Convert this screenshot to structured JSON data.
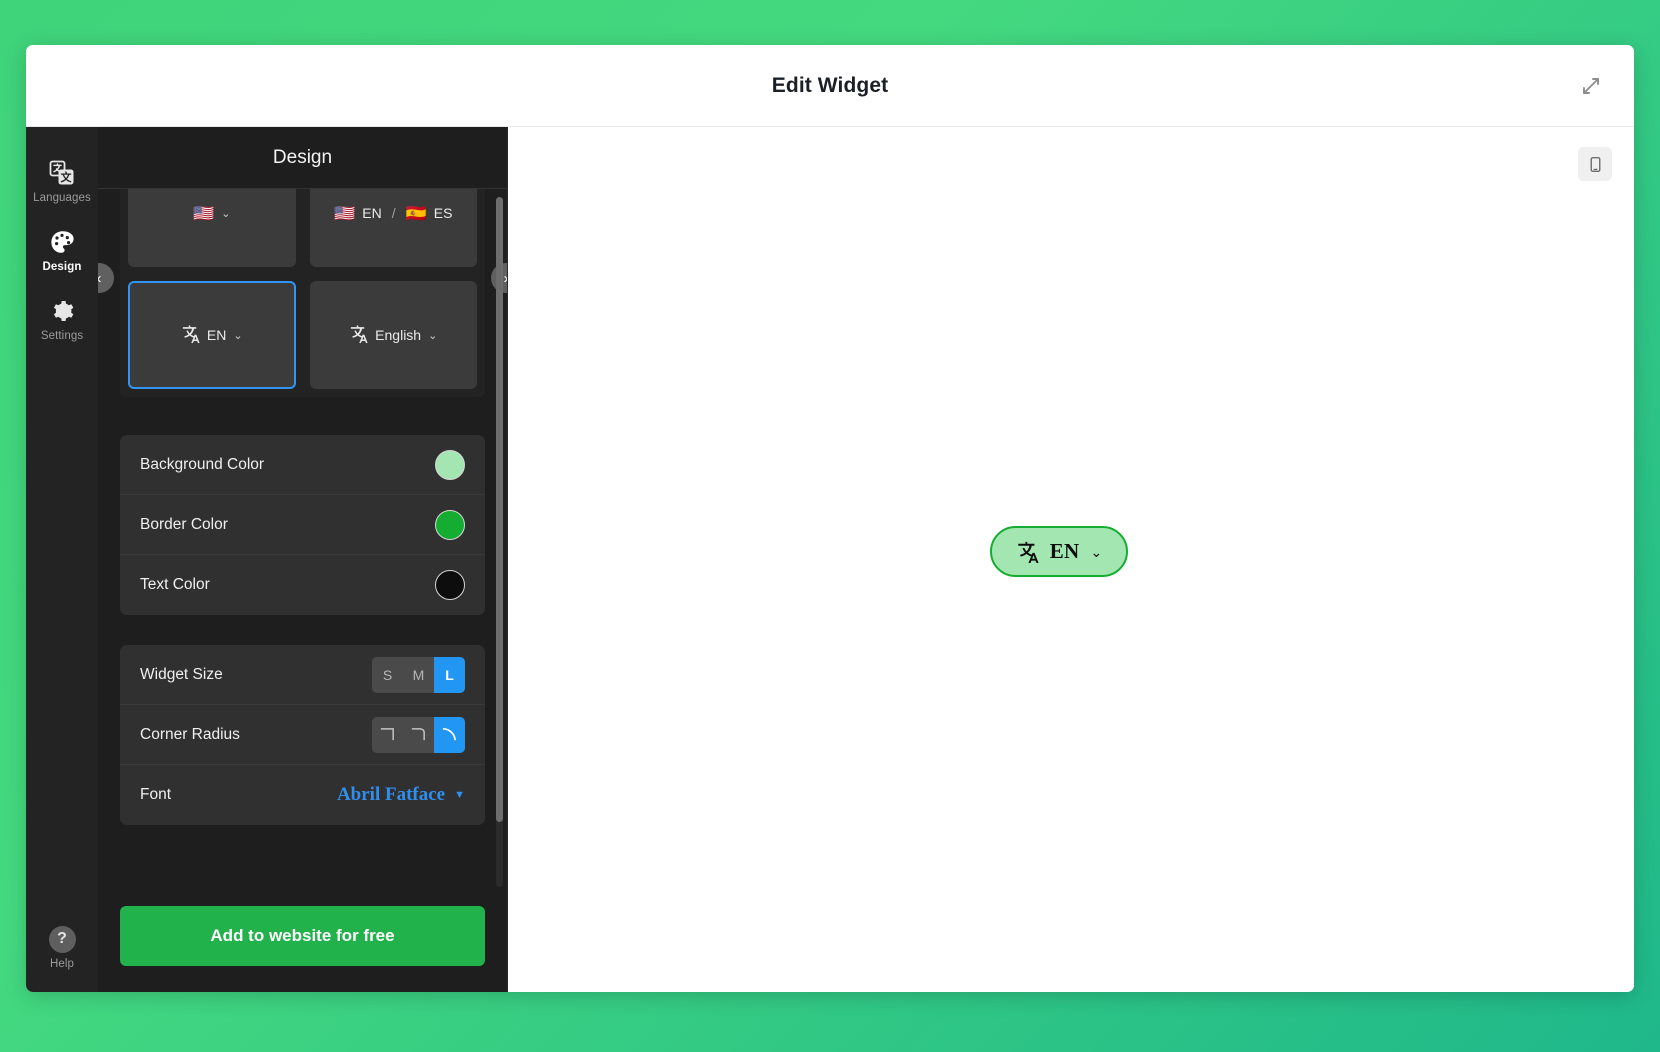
{
  "header": {
    "title": "Edit Widget",
    "expand_icon": "expand-arrows-icon"
  },
  "rail": {
    "items": [
      {
        "label": "Languages",
        "icon": "languages-translate-icon",
        "active": false
      },
      {
        "label": "Design",
        "icon": "palette-icon",
        "active": true
      },
      {
        "label": "Settings",
        "icon": "gear-icon",
        "active": false
      }
    ],
    "help": {
      "label": "Help",
      "icon": "question-mark-icon",
      "glyph": "?"
    }
  },
  "panel": {
    "title": "Design",
    "carousel": {
      "prev_icon": "chevron-left-icon",
      "next_icon": "chevron-right-icon",
      "prev_glyph": "‹",
      "next_glyph": "›",
      "tiles": [
        {
          "id": "flag-dropdown",
          "flag": "🇺🇸",
          "text": "",
          "caret": "⌄",
          "icon": "",
          "selected": false
        },
        {
          "id": "flags-pair",
          "flag": "🇺🇸",
          "text": "EN",
          "separator": "/",
          "flag2": "🇪🇸",
          "text2": "ES",
          "selected": false
        },
        {
          "id": "translate-en",
          "icon": "translate-icon",
          "text": "EN",
          "caret": "⌄",
          "selected": true
        },
        {
          "id": "translate-english",
          "icon": "translate-icon",
          "text": "English",
          "caret": "⌄",
          "selected": false
        }
      ]
    },
    "colors": {
      "rows": [
        {
          "label": "Background Color",
          "value": "#a3e6b1"
        },
        {
          "label": "Border Color",
          "value": "#14ad32"
        },
        {
          "label": "Text Color",
          "value": "#0d0d0d"
        }
      ]
    },
    "appearance": {
      "widget_size": {
        "label": "Widget Size",
        "options": [
          "S",
          "M",
          "L"
        ],
        "selected": "L"
      },
      "corner_radius": {
        "label": "Corner Radius",
        "options": [
          "square",
          "slight",
          "round"
        ],
        "selected": "round"
      },
      "font": {
        "label": "Font",
        "value": "Abril Fatface",
        "caret": "▼"
      }
    },
    "cta_label": "Add to website for free"
  },
  "canvas": {
    "device_toggle": {
      "icon": "mobile-phone-icon"
    },
    "widget": {
      "icon": "translate-icon",
      "label": "EN",
      "caret": "⌄",
      "background": "#a3e6b1",
      "border": "#14ad32",
      "text_color": "#0d0d0d"
    }
  }
}
